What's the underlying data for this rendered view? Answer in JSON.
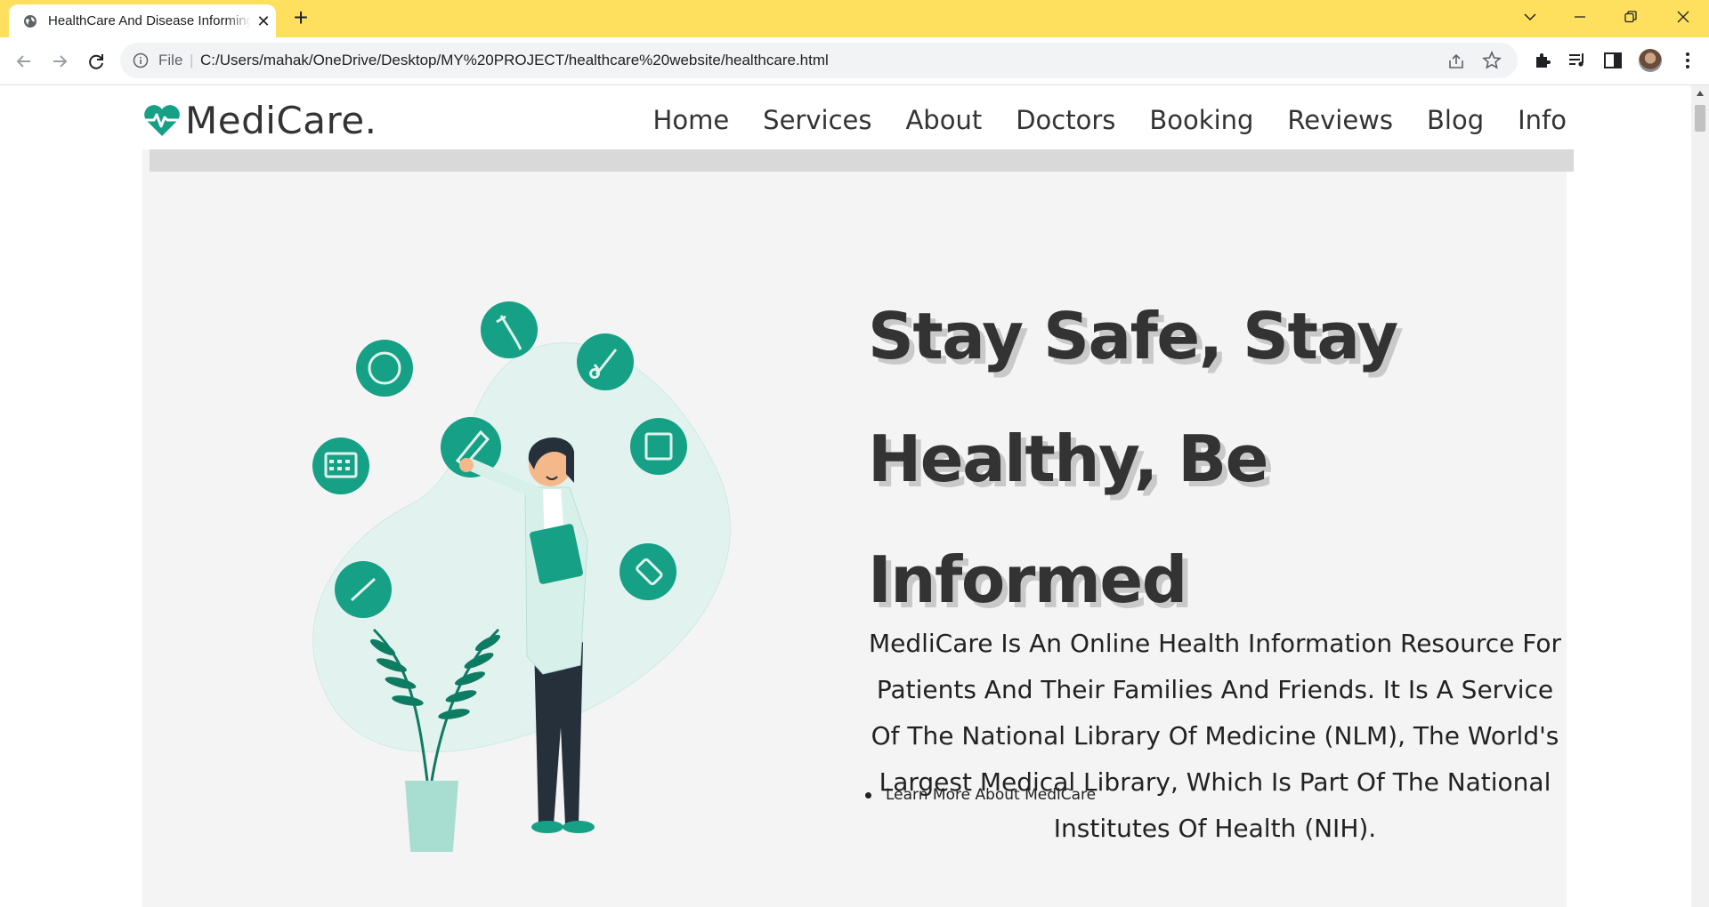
{
  "browser": {
    "tab_title": "HealthCare And Disease Informing Website",
    "url_scheme": "File",
    "url": "C:/Users/mahak/OneDrive/Desktop/MY%20PROJECT/healthcare%20website/healthcare.html",
    "icons": [
      "globe-icon",
      "close-icon",
      "plus-icon",
      "chevron-down-icon",
      "minimize-icon",
      "restore-icon",
      "close-window-icon",
      "back-icon",
      "forward-icon",
      "reload-icon",
      "info-icon",
      "share-icon",
      "star-icon",
      "extensions-icon",
      "media-icon",
      "side-panel-icon",
      "avatar",
      "menu-icon"
    ],
    "accent_color": "#ffe05e"
  },
  "site": {
    "logo_text": "MediCare.",
    "brand_color": "#16a085",
    "nav": [
      "Home",
      "Services",
      "About",
      "Doctors",
      "Booking",
      "Reviews",
      "Blog",
      "Info"
    ]
  },
  "hero": {
    "heading_lines": [
      "Stay Safe, Stay",
      "Healthy, Be",
      "Informed"
    ],
    "description": "MedliCare Is An Online Health Information Resource For Patients And Their Families And Friends. It Is A Service Of The National Library Of Medicine (NLM), The World's Largest Medical Library, Which Is Part Of The National Institutes Of Health (NIH).",
    "link": "Learn More About MediCare"
  }
}
